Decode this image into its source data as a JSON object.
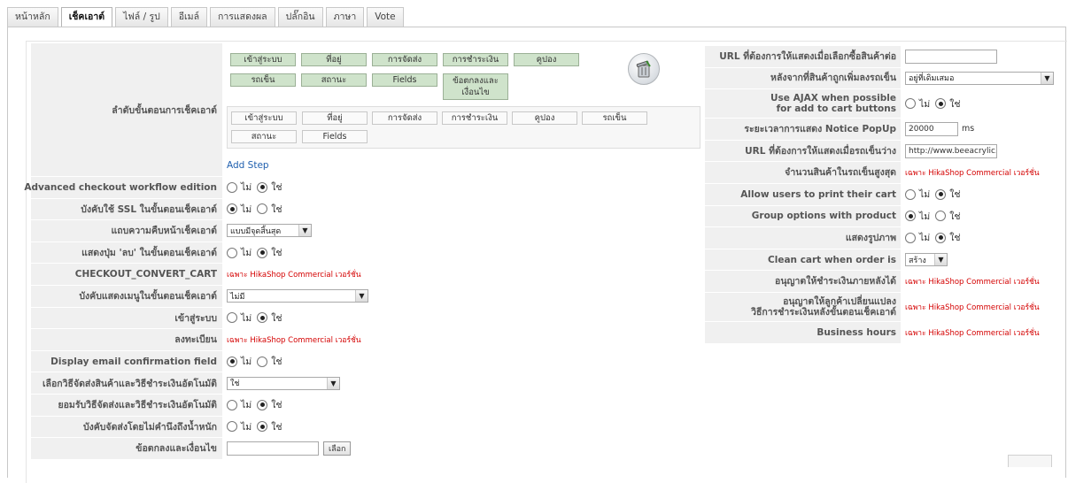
{
  "tabs": [
    "หน้าหลัก",
    "เช็คเอาต์",
    "ไฟล์ / รูป",
    "อีเมล์",
    "การแสดงผล",
    "ปลั๊กอิน",
    "ภาษา",
    "Vote"
  ],
  "active_tab": "เช็คเอาต์",
  "steps": {
    "label": "ลำดับขั้นตอนการเช็คเอาต์",
    "step1": [
      "เข้าสู่ระบบ",
      "ที่อยู่",
      "การจัดส่ง",
      "การชำระเงิน",
      "คูปอง",
      "รถเข็น",
      "สถานะ",
      "Fields",
      "ข้อตกลงและเงื่อนไข"
    ],
    "step2": [
      "เข้าสู่ระบบ",
      "ที่อยู่",
      "การจัดส่ง",
      "การชำระเงิน",
      "คูปอง",
      "รถเข็น",
      "สถานะ",
      "Fields"
    ],
    "add_step": "Add Step"
  },
  "radio": {
    "no": "ไม่",
    "yes": "ใช่"
  },
  "commercial_text": "เฉพาะ HikaShop Commercial เวอร์ชั่น",
  "left": {
    "advanced_workflow": "Advanced checkout workflow edition",
    "force_ssl": "บังคับใช้ SSL ในขั้นตอนเช็คเอาต์",
    "progress_bar": "แถบความคืบหน้าเช็คเอาต์",
    "progress_bar_value": "แบบมีจุดสิ้นสุด",
    "show_delete": "แสดงปุ่ม 'ลบ' ในขั้นตอนเช็คเอาต์",
    "convert_cart": "CHECKOUT_CONVERT_CART",
    "force_menu": "บังคับแสดงเมนูในขั้นตอนเช็คเอาต์",
    "force_menu_value": "ไม่มี",
    "login": "เข้าสู่ระบบ",
    "register": "ลงทะเบียน",
    "email_confirm": "Display email confirmation field",
    "auto_select": "เลือกวิธีจัดส่งสินค้าและวิธีชำระเงินอัตโนมัติ",
    "auto_select_value": "ใช่",
    "auto_submit": "ยอมรับวิธีจัดส่งและวิธีชำระเงินอัตโนมัติ",
    "force_shipping": "บังคับจัดส่งโดยไม่คำนึงถึงน้ำหนัก",
    "terms": "ข้อตกลงและเงื่อนไข",
    "terms_button": "เลือก"
  },
  "right": {
    "url_after_checkout": "URL ที่ต้องการให้แสดงเมื่อเลือกซื้อสินค้าต่อ",
    "after_add_to_cart": "หลังจากที่สินค้าถูกเพิ่มลงรถเข็น",
    "after_add_to_cart_value": "อยู่ที่เดิมเสมอ",
    "use_ajax_1": "Use AJAX when possible",
    "use_ajax_2": "for add to cart buttons",
    "notice_popup": "ระยะเวลาการแสดง Notice PopUp",
    "notice_popup_value": "20000",
    "notice_popup_unit": "ms",
    "url_empty_cart": "URL ที่ต้องการให้แสดงเมื่อรถเข็นว่าง",
    "url_empty_cart_value": "http://www.beeacrylic.",
    "max_products": "จำนวนสินค้าในรถเข็นสูงสุด",
    "print_cart": "Allow users to print their cart",
    "group_options": "Group options with product",
    "show_image": "แสดงรูปภาพ",
    "clean_cart": "Clean cart when order is",
    "clean_cart_value": "สร้าง",
    "allow_pay_later": "อนุญาตให้ชำระเงินภายหลังได้",
    "allow_change_1": "อนุญาตให้ลูกค้าเปลี่ยนแปลง",
    "allow_change_2": "วิธีการชำระเงินหลังขั้นตอนเช็คเอาต์",
    "business_hours": "Business hours"
  }
}
